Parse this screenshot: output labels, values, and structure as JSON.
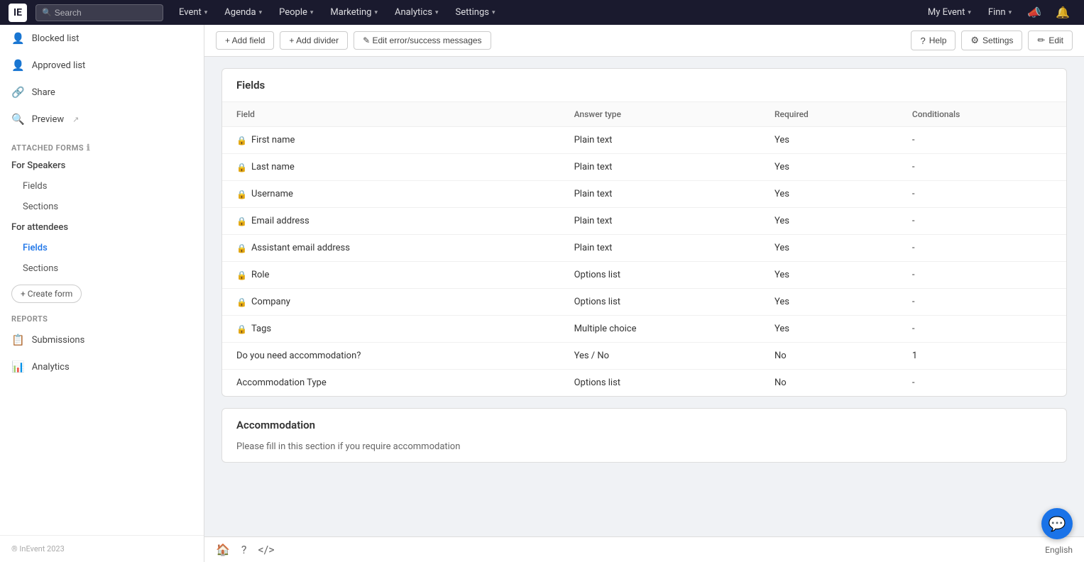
{
  "topNav": {
    "logoText": "IE",
    "searchPlaceholder": "Search",
    "items": [
      {
        "label": "Event",
        "hasDropdown": true
      },
      {
        "label": "Agenda",
        "hasDropdown": true
      },
      {
        "label": "People",
        "hasDropdown": true
      },
      {
        "label": "Marketing",
        "hasDropdown": true
      },
      {
        "label": "Analytics",
        "hasDropdown": true
      },
      {
        "label": "Settings",
        "hasDropdown": true
      }
    ],
    "rightItems": [
      {
        "label": "My Event",
        "hasDropdown": true
      },
      {
        "label": "Finn",
        "hasDropdown": true
      }
    ]
  },
  "sidebar": {
    "items": [
      {
        "icon": "👤",
        "label": "Blocked list"
      },
      {
        "icon": "👤",
        "label": "Approved list"
      },
      {
        "icon": "🔗",
        "label": "Share"
      },
      {
        "icon": "🔍",
        "label": "Preview",
        "hasExternal": true
      }
    ],
    "attachedForms": {
      "label": "ATTACHED FORMS",
      "hasInfo": true,
      "groups": [
        {
          "label": "For Speakers",
          "children": [
            {
              "label": "Fields",
              "active": false
            },
            {
              "label": "Sections",
              "active": false
            }
          ]
        },
        {
          "label": "For attendees",
          "children": [
            {
              "label": "Fields",
              "active": true
            },
            {
              "label": "Sections",
              "active": false
            }
          ]
        }
      ],
      "createFormLabel": "+ Create form"
    },
    "reports": {
      "label": "REPORTS",
      "items": [
        {
          "icon": "📋",
          "label": "Submissions"
        },
        {
          "icon": "📊",
          "label": "Analytics"
        }
      ]
    },
    "footer": "® InEvent 2023"
  },
  "toolbar": {
    "addFieldLabel": "+ Add field",
    "addDividerLabel": "+ Add divider",
    "editMessagesLabel": "✎ Edit error/success messages",
    "helpLabel": "Help",
    "settingsLabel": "Settings",
    "editLabel": "Edit"
  },
  "fieldsCard": {
    "title": "Fields",
    "columns": [
      "Field",
      "Answer type",
      "Required",
      "Conditionals"
    ],
    "rows": [
      {
        "locked": true,
        "field": "First name",
        "answerType": "Plain text",
        "required": "Yes",
        "conditionals": "-"
      },
      {
        "locked": true,
        "field": "Last name",
        "answerType": "Plain text",
        "required": "Yes",
        "conditionals": "-"
      },
      {
        "locked": true,
        "field": "Username",
        "answerType": "Plain text",
        "required": "Yes",
        "conditionals": "-"
      },
      {
        "locked": true,
        "field": "Email address",
        "answerType": "Plain text",
        "required": "Yes",
        "conditionals": "-"
      },
      {
        "locked": true,
        "field": "Assistant email address",
        "answerType": "Plain text",
        "required": "Yes",
        "conditionals": "-"
      },
      {
        "locked": true,
        "field": "Role",
        "answerType": "Options list",
        "required": "Yes",
        "conditionals": "-"
      },
      {
        "locked": true,
        "field": "Company",
        "answerType": "Options list",
        "required": "Yes",
        "conditionals": "-"
      },
      {
        "locked": true,
        "field": "Tags",
        "answerType": "Multiple choice",
        "required": "Yes",
        "conditionals": "-"
      },
      {
        "locked": false,
        "field": "Do you need accommodation?",
        "answerType": "Yes / No",
        "required": "No",
        "conditionals": "1"
      },
      {
        "locked": false,
        "field": "Accommodation Type",
        "answerType": "Options list",
        "required": "No",
        "conditionals": "-"
      }
    ]
  },
  "accommodationCard": {
    "title": "Accommodation",
    "description": "Please fill in this section if you require accommodation"
  },
  "bottomBar": {
    "language": "English"
  }
}
